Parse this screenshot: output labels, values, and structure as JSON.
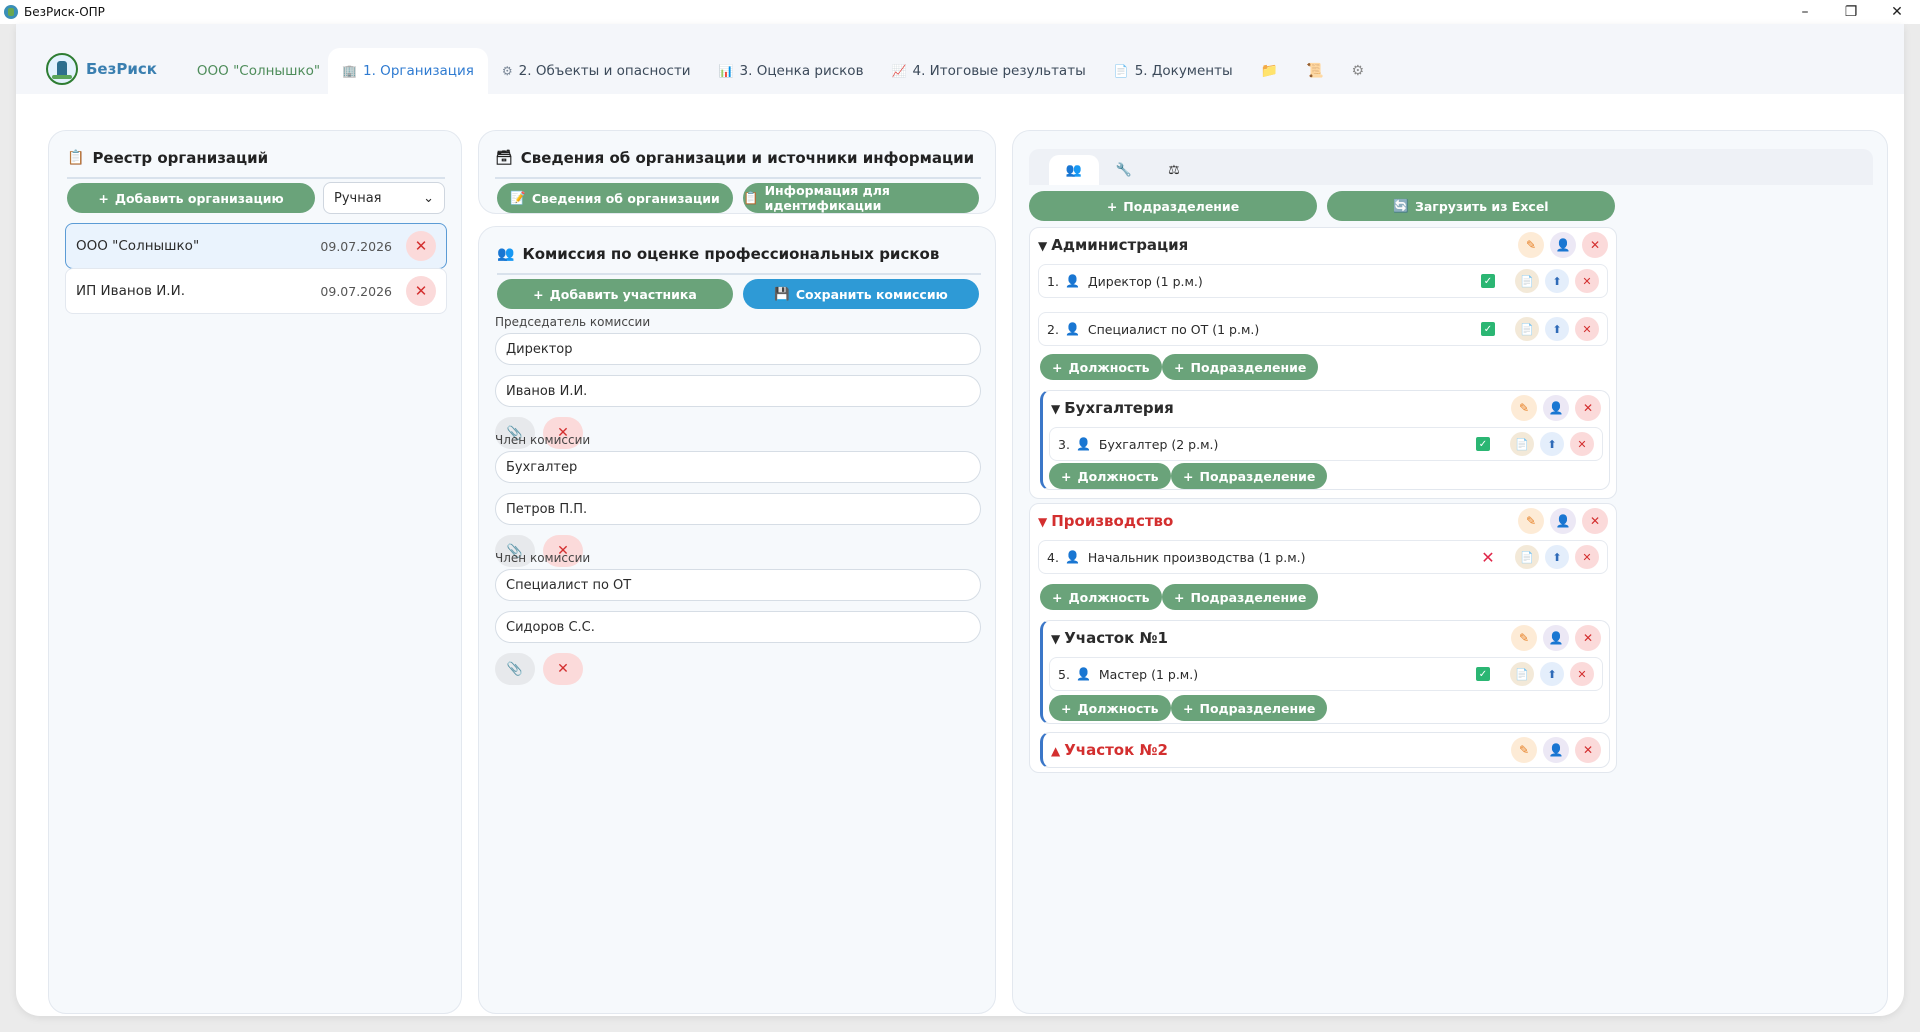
{
  "window": {
    "title": "БезРиск-ОПР",
    "minimize": "–",
    "restore": "❐",
    "close": "✕"
  },
  "nav": {
    "brand": "БезРиск",
    "org": "ООО \"Солнышко\"",
    "tabs": [
      {
        "icon": "🏢",
        "label": "1. Организация"
      },
      {
        "icon": "⚙",
        "label": "2. Объекты и опасности"
      },
      {
        "icon": "📊",
        "label": "3. Оценка рисков"
      },
      {
        "icon": "📈",
        "label": "4. Итоговые результаты"
      },
      {
        "icon": "📄",
        "label": "5. Документы"
      }
    ],
    "icon_tabs": [
      "📁",
      "📜",
      "⚙"
    ]
  },
  "registry": {
    "icon": "📋",
    "title": "Реестр организаций",
    "add_button": "Добавить организацию",
    "mode_select": "Ручная",
    "orgs": [
      {
        "name": "ООО \"Солнышко\"",
        "date": "09.07.2026"
      },
      {
        "name": "ИП Иванов И.И.",
        "date": "09.07.2026"
      }
    ]
  },
  "info": {
    "icon": "🗃",
    "title": "Сведения об организации и источники информации",
    "btn_org": "Сведения об организации",
    "btn_ident": "Информация для идентификации"
  },
  "commission": {
    "icon": "👥",
    "title": "Комиссия по оценке профессиональных рисков",
    "add_button": "Добавить участника",
    "save_button": "Сохранить комиссию",
    "members": [
      {
        "role": "Председатель комиссии",
        "position": "Директор",
        "name": "Иванов И.И."
      },
      {
        "role": "Член комиссии",
        "position": "Бухгалтер",
        "name": "Петров П.П."
      },
      {
        "role": "Член комиссии",
        "position": "Специалист по ОТ",
        "name": "Сидоров С.С."
      }
    ]
  },
  "structure": {
    "subtabs": [
      "👥",
      "🔧",
      "⚖"
    ],
    "btn_add_dept": "Подразделение",
    "btn_excel": "Загрузить из Excel",
    "pill_position": "Должность",
    "pill_dept": "Подразделение",
    "departments": {
      "admin": {
        "name": "Администрация",
        "positions": [
          {
            "num": "1.",
            "text": "Директор (1 р.м.)"
          },
          {
            "num": "2.",
            "text": "Специалист по ОТ (1 р.м.)"
          }
        ]
      },
      "accounting": {
        "name": "Бухгалтерия",
        "positions": [
          {
            "num": "3.",
            "text": "Бухгалтер (2 р.м.)"
          }
        ]
      },
      "production": {
        "name": "Производство",
        "positions": [
          {
            "num": "4.",
            "text": "Начальник производства (1 р.м.)"
          }
        ]
      },
      "site1": {
        "name": "Участок №1",
        "positions": [
          {
            "num": "5.",
            "text": "Мастер (1 р.м.)"
          }
        ]
      },
      "site2": {
        "name": "Участок №2"
      }
    },
    "colors": {
      "accent_green": "#6aa37a",
      "accent_blue": "#2e9ad6",
      "warning_red": "#d32f2f"
    }
  }
}
